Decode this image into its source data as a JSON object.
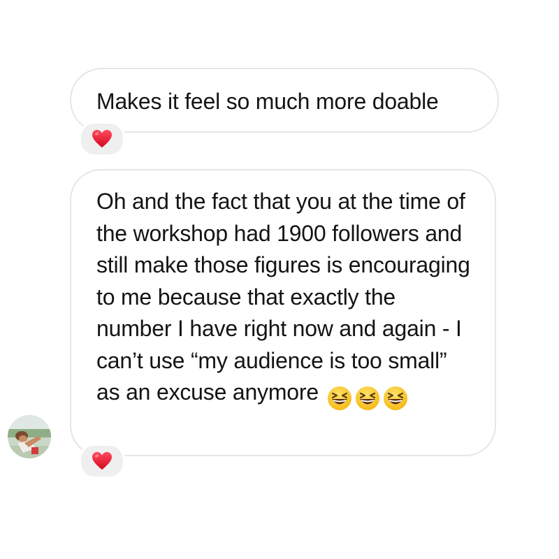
{
  "messages": [
    {
      "text": "Makes it feel so much more doable",
      "reaction": "heart-icon"
    },
    {
      "text": "Oh and the fact that you at the time of the workshop had 1900 followers and still make those figures is encouraging to me because that exactly the number I have right now and again - I can’t use “my audience is too small” as an excuse anymore",
      "trailing_emoji": [
        "grinning-squinting-face",
        "grinning-squinting-face",
        "grinning-squinting-face"
      ],
      "reaction": "heart-icon"
    }
  ],
  "colors": {
    "bubble_border": "#e6e6e6",
    "reaction_bg": "#efefef",
    "heart": "#e8132d",
    "text": "#141414"
  }
}
